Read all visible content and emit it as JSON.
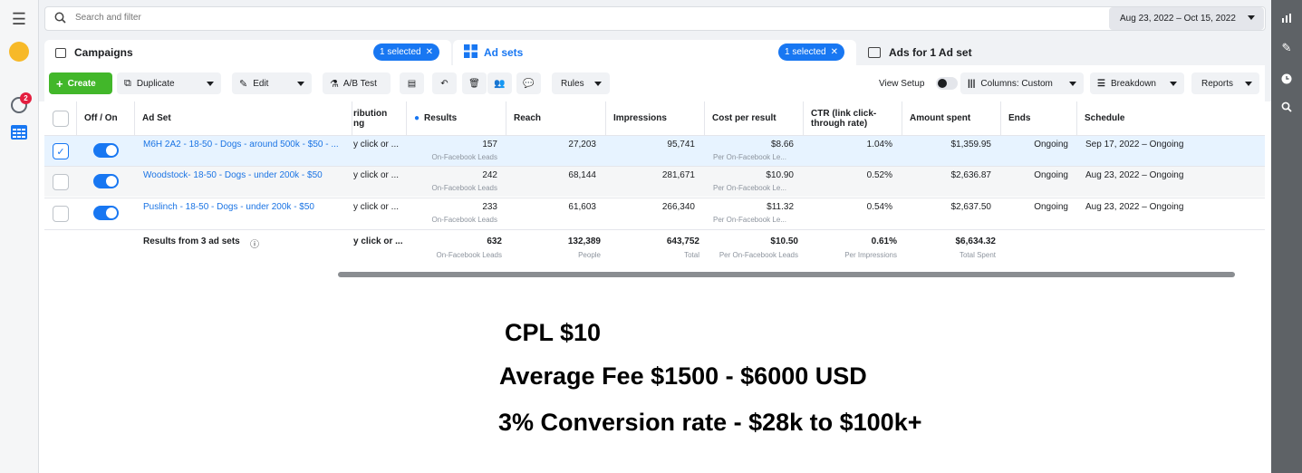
{
  "search": {
    "placeholder": "Search and filter"
  },
  "date_range": "Aug 23, 2022 – Oct 15, 2022",
  "tabs": {
    "campaigns": "Campaigns",
    "campaigns_pill": "1 selected",
    "adsets": "Ad sets",
    "adsets_pill": "1 selected",
    "ads": "Ads for 1 Ad set"
  },
  "toolbar": {
    "create": "Create",
    "duplicate": "Duplicate",
    "edit": "Edit",
    "ab_test": "A/B Test",
    "rules": "Rules",
    "view_setup": "View Setup",
    "columns": "Columns: Custom",
    "breakdown": "Breakdown",
    "reports": "Reports"
  },
  "columns": {
    "offon": "Off / On",
    "adset": "Ad Set",
    "attribution": "ribution\nng",
    "results": "Results",
    "reach": "Reach",
    "impressions": "Impressions",
    "cpr": "Cost per result",
    "ctr": "CTR (link click-through rate)",
    "spent": "Amount spent",
    "ends": "Ends",
    "schedule": "Schedule"
  },
  "rows": [
    {
      "name": "M6H 2A2 - 18-50 - Dogs - around 500k - $50 - ...",
      "attr": "y click or ...",
      "results": "157",
      "results_sub": "On-Facebook Leads",
      "reach": "27,203",
      "impressions": "95,741",
      "cpr": "$8.66",
      "cpr_sub": "Per On-Facebook Le...",
      "ctr": "1.04%",
      "spent": "$1,359.95",
      "ends": "Ongoing",
      "schedule": "Sep 17, 2022 – Ongoing"
    },
    {
      "name": "Woodstock- 18-50 - Dogs - under 200k - $50",
      "attr": "y click or ...",
      "results": "242",
      "results_sub": "On-Facebook Leads",
      "reach": "68,144",
      "impressions": "281,671",
      "cpr": "$10.90",
      "cpr_sub": "Per On-Facebook Le...",
      "ctr": "0.52%",
      "spent": "$2,636.87",
      "ends": "Ongoing",
      "schedule": "Aug 23, 2022 – Ongoing"
    },
    {
      "name": "Puslinch - 18-50 - Dogs - under 200k - $50",
      "attr": "y click or ...",
      "results": "233",
      "results_sub": "On-Facebook Leads",
      "reach": "61,603",
      "impressions": "266,340",
      "cpr": "$11.32",
      "cpr_sub": "Per On-Facebook Le...",
      "ctr": "0.54%",
      "spent": "$2,637.50",
      "ends": "Ongoing",
      "schedule": "Aug 23, 2022 – Ongoing"
    }
  ],
  "totals": {
    "label": "Results from 3 ad sets",
    "attr": "y click or ...",
    "results": "632",
    "results_sub": "On-Facebook Leads",
    "reach": "132,389",
    "reach_sub": "People",
    "impressions": "643,752",
    "impressions_sub": "Total",
    "cpr": "$10.50",
    "cpr_sub": "Per On-Facebook Leads",
    "ctr": "0.61%",
    "ctr_sub": "Per Impressions",
    "spent": "$6,634.32",
    "spent_sub": "Total Spent"
  },
  "notes": {
    "line1": "CPL $10",
    "line2": "Average Fee $1500 - $6000 USD",
    "line3": "3% Conversion rate - $28k to $100k+"
  },
  "notification_count": "2"
}
